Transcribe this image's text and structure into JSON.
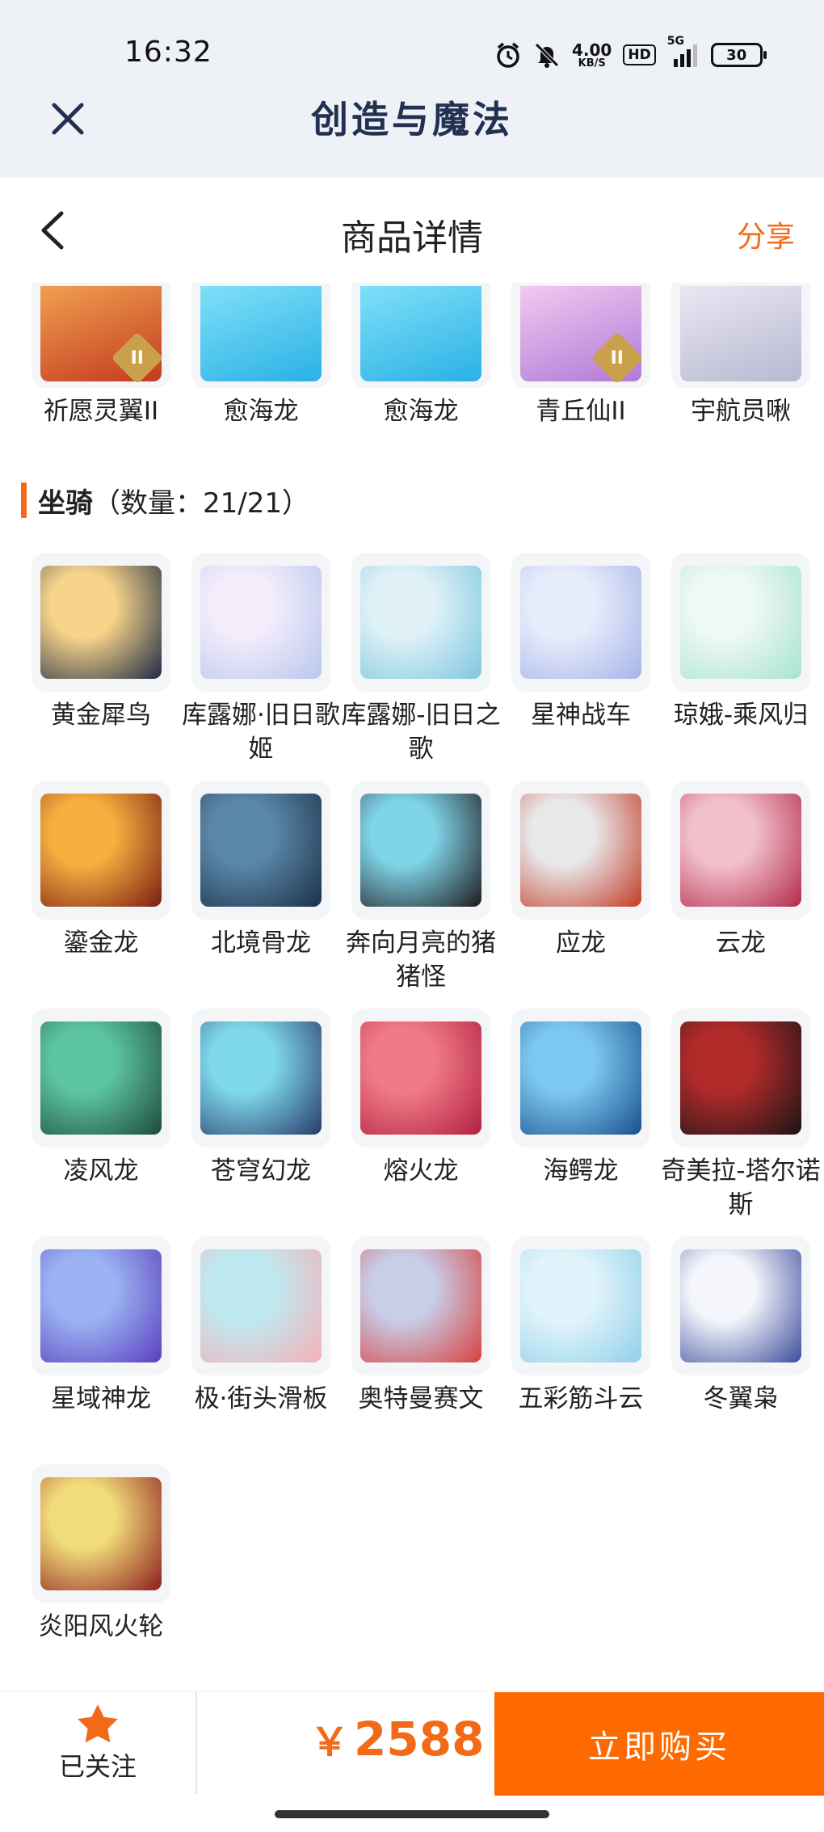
{
  "status_bar": {
    "time": "16:32",
    "net_speed": "4.00",
    "net_unit": "KB/S",
    "hd": "HD",
    "signal": "5G",
    "battery": "30"
  },
  "app_bar": {
    "title": "创造与魔法"
  },
  "nav": {
    "title": "商品详情",
    "share": "分享"
  },
  "prev_items": [
    {
      "label": "祈愿灵翼II",
      "icon": "phoenix",
      "color_a": "#f0a050",
      "color_b": "#c43a20",
      "badge": "II"
    },
    {
      "label": "愈海龙",
      "icon": "ice-dragon",
      "color_a": "#7fe0f8",
      "color_b": "#2bb0e6",
      "badge": ""
    },
    {
      "label": "愈海龙",
      "icon": "ice-dragon",
      "color_a": "#7fe0f8",
      "color_b": "#2bb0e6",
      "badge": ""
    },
    {
      "label": "青丘仙II",
      "icon": "fox-fairy",
      "color_a": "#f4c8f0",
      "color_b": "#b07ad8",
      "badge": "II"
    },
    {
      "label": "宇航员啾",
      "icon": "astronaut",
      "color_a": "#e8e8f4",
      "color_b": "#b8b8d0",
      "badge": ""
    }
  ],
  "section": {
    "title": "坐骑",
    "count": "（数量：21/21）"
  },
  "mounts": [
    {
      "label": "黄金犀鸟",
      "color_a": "#f7d48a",
      "color_b": "#1d2a44"
    },
    {
      "label": "库露娜·旧日歌姬",
      "color_a": "#f2ecfb",
      "color_b": "#b9c6ef"
    },
    {
      "label": "库露娜-旧日之歌",
      "color_a": "#dff1f7",
      "color_b": "#7dc7e0"
    },
    {
      "label": "星神战车",
      "color_a": "#e7ecfb",
      "color_b": "#a6b4ea"
    },
    {
      "label": "琼娥-乘风归",
      "color_a": "#eef8f4",
      "color_b": "#a6e3d2"
    },
    {
      "label": "鎏金龙",
      "color_a": "#f5b040",
      "color_b": "#7a1c12"
    },
    {
      "label": "北境骨龙",
      "color_a": "#5a86a8",
      "color_b": "#1b3148"
    },
    {
      "label": "奔向月亮的猪猪怪",
      "color_a": "#7fd4e8",
      "color_b": "#1e1a1c"
    },
    {
      "label": "应龙",
      "color_a": "#e8e8ea",
      "color_b": "#c23a24"
    },
    {
      "label": "云龙",
      "color_a": "#f2c0cc",
      "color_b": "#b32a4a"
    },
    {
      "label": "凌风龙",
      "color_a": "#5cc4a0",
      "color_b": "#1d4a3c"
    },
    {
      "label": "苍穹幻龙",
      "color_a": "#7ed8ea",
      "color_b": "#283a6a"
    },
    {
      "label": "熔火龙",
      "color_a": "#f07a86",
      "color_b": "#b22040"
    },
    {
      "label": "海鳄龙",
      "color_a": "#7cc8f0",
      "color_b": "#1a4f8c"
    },
    {
      "label": "奇美拉-塔尔诺斯",
      "color_a": "#b02a2a",
      "color_b": "#1a1416"
    },
    {
      "label": "星域神龙",
      "color_a": "#9bb3f2",
      "color_b": "#5a3ec0"
    },
    {
      "label": "极·街头滑板",
      "color_a": "#bfe9f0",
      "color_b": "#f5b0b8"
    },
    {
      "label": "奥特曼赛文",
      "color_a": "#c8cde8",
      "color_b": "#d8403c"
    },
    {
      "label": "五彩筋斗云",
      "color_a": "#e2f4fb",
      "color_b": "#8fd0ea"
    },
    {
      "label": "冬翼枭",
      "color_a": "#f4f6fc",
      "color_b": "#3c4c9c"
    },
    {
      "label": "炎阳风火轮",
      "color_a": "#f2dc7a",
      "color_b": "#8c1c1c"
    }
  ],
  "footer": {
    "follow": "已关注",
    "currency": "￥",
    "price": "2588",
    "buy": "立即购买"
  },
  "colors": {
    "accent": "#f26a17",
    "buy": "#ff6a00",
    "app_bg": "#eef2f6"
  }
}
